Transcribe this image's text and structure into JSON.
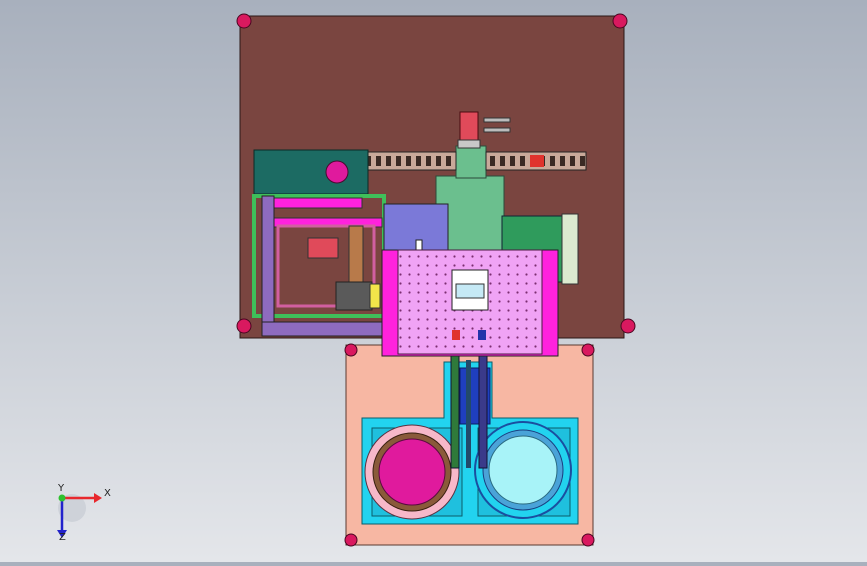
{
  "view": {
    "type": "cad-assembly-top-view",
    "background_color": "#b9bfc9"
  },
  "axes_triad": {
    "x_label": "X",
    "y_label": "Y",
    "z_label": "Z",
    "x_color": "#e8282d",
    "y_color": "#2ec12e",
    "z_color": "#2222cc"
  },
  "colors": {
    "base_plate": "#7a4540",
    "corner_feet": "#d9195f",
    "lower_housing": "#f7b7a3",
    "tray": "#22d3ef",
    "magenta_disc": "#e01a9d",
    "cyan_disc": "#a8f3f8",
    "perforated_plate": "#f0a3f5",
    "magenta_frame": "#ff22dd",
    "lavender_block": "#7b79d8",
    "green_block": "#6bbf8e",
    "dark_green_box": "#2f9b5c",
    "teal_motor": "#1c6b63",
    "chain": "#c9a99a",
    "purple_bracket": "#8e6bbf"
  }
}
